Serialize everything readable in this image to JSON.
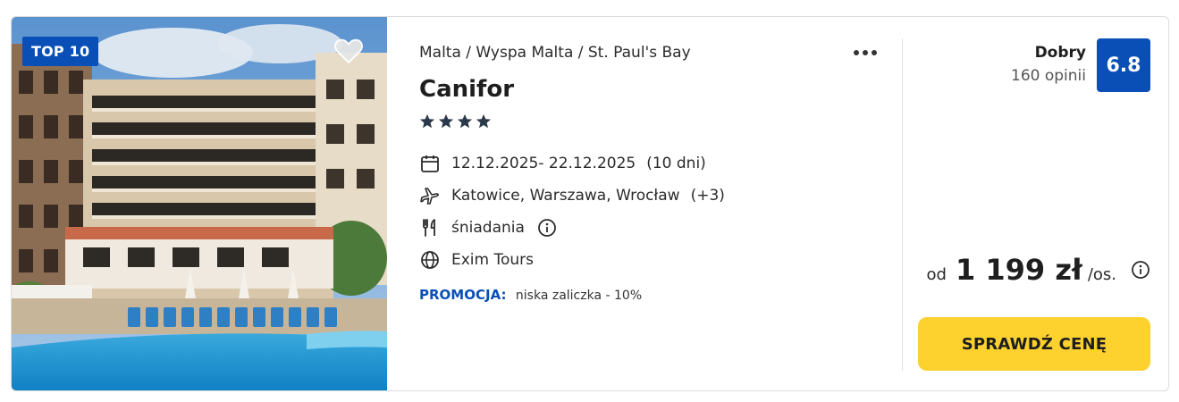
{
  "offer": {
    "badge": "TOP 10",
    "breadcrumb": "Malta / Wyspa Malta / St. Paul's Bay",
    "hotel_name": "Canifor",
    "stars": 4,
    "dates": "12.12.2025- 22.12.2025",
    "duration": "(10 dni)",
    "departures": "Katowice, Warszawa, Wrocław",
    "departures_more": "(+3)",
    "board": "śniadania",
    "operator": "Exim Tours",
    "promo_label": "PROMOCJA:",
    "promo_text": "niska zaliczka - 10%"
  },
  "rating": {
    "label": "Dobry",
    "count": "160 opinii",
    "score": "6.8"
  },
  "price": {
    "prefix": "od",
    "value": "1 199 zł",
    "suffix": "/os."
  },
  "cta_label": "SPRAWDŹ CENĘ",
  "colors": {
    "brand_blue": "#0a4fb6",
    "cta_yellow": "#fdd12e",
    "text": "#2b2b2b"
  },
  "icons": [
    "heart-icon",
    "more-icon",
    "star-icon",
    "calendar-icon",
    "plane-icon",
    "cutlery-icon",
    "info-icon",
    "globe-icon"
  ]
}
